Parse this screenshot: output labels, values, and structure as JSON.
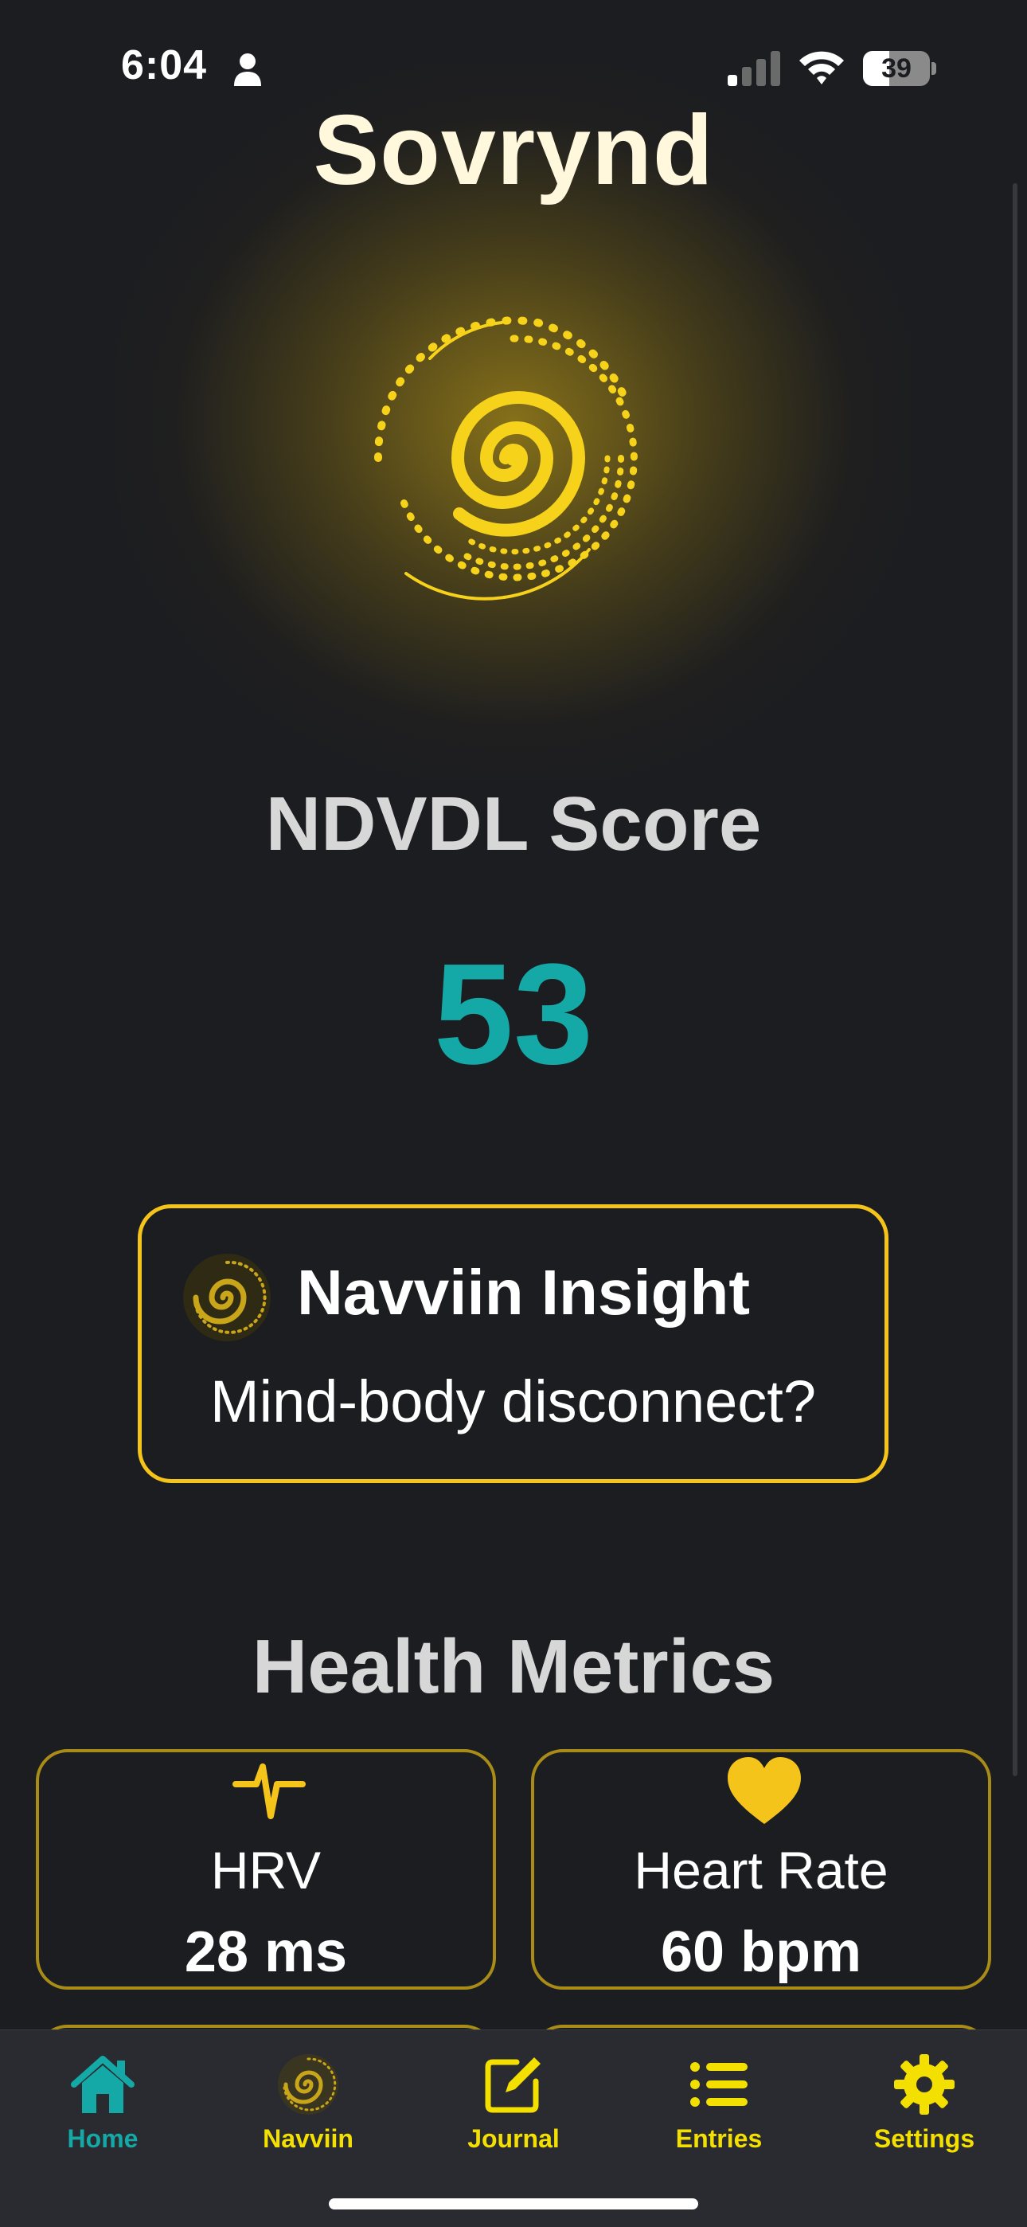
{
  "status_bar": {
    "time": "6:04",
    "battery_level": "39",
    "battery_fraction": 0.39,
    "icons": [
      "person-icon",
      "signal-icon",
      "wifi-icon",
      "battery-icon"
    ]
  },
  "header": {
    "app_title": "Sovrynd"
  },
  "score": {
    "label": "NDVDL Score",
    "value": "53"
  },
  "insight": {
    "title": "Navviin Insight",
    "text": "Mind-body disconnect?",
    "icon": "spiral-icon"
  },
  "health_metrics": {
    "section_title": "Health Metrics",
    "cards": [
      {
        "label": "HRV",
        "value": "28 ms",
        "icon": "pulse-icon"
      },
      {
        "label": "Heart Rate",
        "value": "60 bpm",
        "icon": "heart-icon"
      }
    ]
  },
  "tab_bar": {
    "tabs": [
      {
        "label": "Home",
        "icon": "home-icon",
        "active": true
      },
      {
        "label": "Navviin",
        "icon": "spiral-icon",
        "active": false
      },
      {
        "label": "Journal",
        "icon": "compose-icon",
        "active": false
      },
      {
        "label": "Entries",
        "icon": "list-icon",
        "active": false
      },
      {
        "label": "Settings",
        "icon": "gear-icon",
        "active": false
      }
    ]
  },
  "colors": {
    "background": "#1c1d21",
    "accent_yellow": "#f4c41a",
    "accent_teal": "#14a9a6",
    "tab_bar_bg": "#2a2b30"
  }
}
